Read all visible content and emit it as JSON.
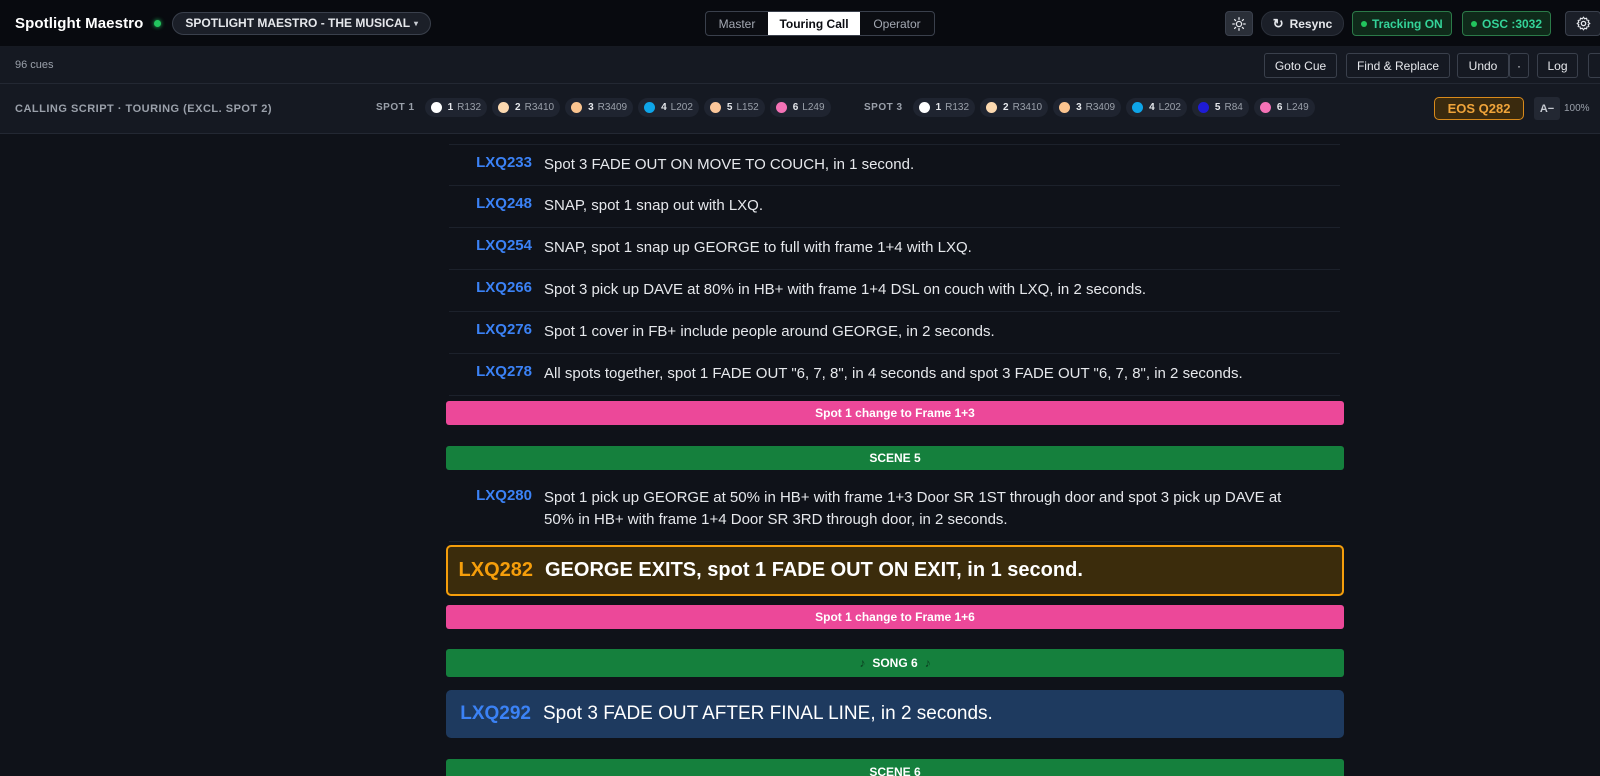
{
  "app": {
    "title": "Spotlight Maestro",
    "show": "SPOTLIGHT MAESTRO - THE MUSICAL",
    "show_caret": "▾"
  },
  "modes": [
    "Master",
    "Touring Call",
    "Operator"
  ],
  "header_actions": {
    "theme_icon": "sun-icon",
    "resync": "Resync",
    "tracking": "Tracking ON",
    "osc": "OSC :3032",
    "settings_icon": "gear-icon"
  },
  "toolbar": {
    "cue_count": "96 cues",
    "goto": "Goto Cue",
    "find": "Find & Replace",
    "undo": "Undo",
    "undo_more": "·",
    "log": "Log"
  },
  "spotbar": {
    "script_label": "CALLING SCRIPT · TOURING (EXCL. SPOT 2)",
    "spots": [
      {
        "name": "SPOT 1",
        "chips": [
          {
            "num": "1",
            "gel": "R132",
            "color": "#ffffff"
          },
          {
            "num": "2",
            "gel": "R3410",
            "color": "#fcd9b0"
          },
          {
            "num": "3",
            "gel": "R3409",
            "color": "#fbc48f"
          },
          {
            "num": "4",
            "gel": "L202",
            "color": "#0ea5e9"
          },
          {
            "num": "5",
            "gel": "L152",
            "color": "#fcc79a"
          },
          {
            "num": "6",
            "gel": "L249",
            "color": "#f472b6"
          }
        ]
      },
      {
        "name": "SPOT 3",
        "chips": [
          {
            "num": "1",
            "gel": "R132",
            "color": "#ffffff"
          },
          {
            "num": "2",
            "gel": "R3410",
            "color": "#fcd9b0"
          },
          {
            "num": "3",
            "gel": "R3409",
            "color": "#fbc48f"
          },
          {
            "num": "4",
            "gel": "L202",
            "color": "#0ea5e9"
          },
          {
            "num": "5",
            "gel": "R84",
            "color": "#1e1bd6"
          },
          {
            "num": "6",
            "gel": "L249",
            "color": "#f472b6"
          }
        ]
      }
    ],
    "eos": "EOS Q282",
    "font_decrease": "A−",
    "zoom": "100%"
  },
  "script": {
    "cues": [
      {
        "id": "LXQ233",
        "text": "Spot 3 FADE OUT ON MOVE TO COUCH, in 1 second."
      },
      {
        "id": "LXQ248",
        "text": "SNAP, spot 1 snap out with LXQ."
      },
      {
        "id": "LXQ254",
        "text": "SNAP, spot 1 snap up GEORGE to full with frame 1+4 with LXQ."
      },
      {
        "id": "LXQ266",
        "text": "Spot 3 pick up DAVE at 80% in HB+ with frame 1+4 DSL on couch with LXQ, in 2 seconds."
      },
      {
        "id": "LXQ276",
        "text": "Spot 1 cover in FB+ include people around GEORGE, in 2 seconds."
      },
      {
        "id": "LXQ278",
        "text": "All spots together, spot 1 FADE OUT \"6, 7, 8\", in 4 seconds and spot 3 FADE OUT \"6, 7, 8\", in 2 seconds."
      }
    ],
    "note_frame_a": "Spot 1 change to Frame 1+3",
    "scene5": "SCENE 5",
    "cue280": {
      "id": "LXQ280",
      "text": "Spot 1 pick up GEORGE at 50% in HB+ with frame 1+3 Door SR 1ST through door and spot 3 pick up DAVE at 50% in HB+ with frame 1+4 Door SR 3RD through door, in 2 seconds."
    },
    "active_cue": {
      "id": "LXQ282",
      "text": "GEORGE EXITS, spot 1 FADE OUT ON EXIT, in 1 second."
    },
    "note_frame_b": "Spot 1 change to Frame 1+6",
    "song6": "SONG 6",
    "song_glyph": "♪",
    "next_cue": {
      "id": "LXQ292",
      "text": "Spot 3 FADE OUT AFTER FINAL LINE, in 2 seconds."
    },
    "scene6": "SCENE 6"
  }
}
